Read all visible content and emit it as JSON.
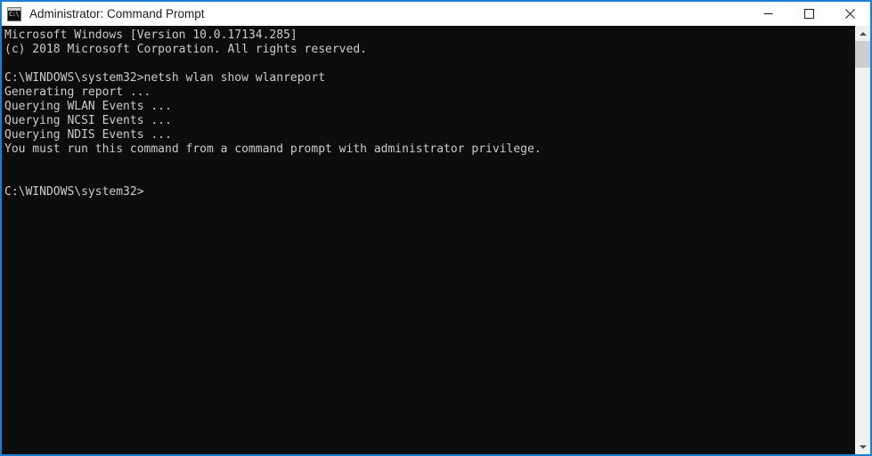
{
  "window": {
    "title": "Administrator: Command Prompt",
    "icon_name": "cmd-icon",
    "icon_glyph": "C:\\",
    "border_color": "#1a7fd4",
    "titlebar_bg": "#ffffff",
    "title_color": "#1a1a1a"
  },
  "controls": {
    "minimize_label": "Minimize",
    "maximize_label": "Maximize",
    "close_label": "Close"
  },
  "console": {
    "background": "#0c0c0c",
    "foreground": "#cccccc",
    "lines": [
      "Microsoft Windows [Version 10.0.17134.285]",
      "(c) 2018 Microsoft Corporation. All rights reserved.",
      "",
      "C:\\WINDOWS\\system32>netsh wlan show wlanreport",
      "Generating report ...",
      "Querying WLAN Events ...",
      "Querying NCSI Events ...",
      "Querying NDIS Events ...",
      "You must run this command from a command prompt with administrator privilege.",
      "",
      "",
      "C:\\WINDOWS\\system32>"
    ]
  },
  "scrollbar": {
    "up_arrow_name": "scroll-up-arrow",
    "down_arrow_name": "scroll-down-arrow",
    "thumb_name": "scrollbar-thumb",
    "thumb_color": "#cdcdcd",
    "track_color": "#f0f0f0"
  }
}
